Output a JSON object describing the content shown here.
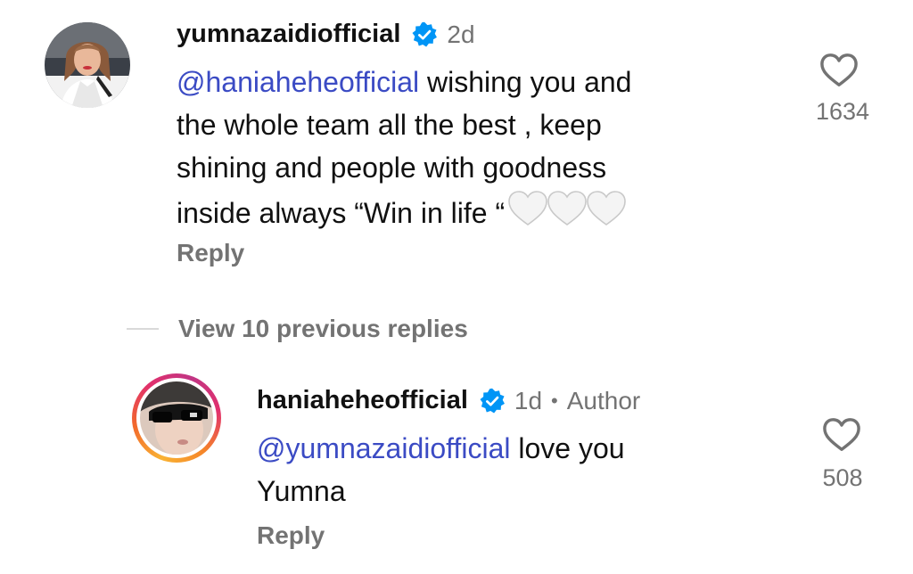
{
  "comment": {
    "username": "yumnazaidiofficial",
    "verified": true,
    "time": "2d",
    "mention": "@haniaheheofficial",
    "lines": [
      " wishing you and",
      "the whole team all the best , keep",
      "shining and people with goodness",
      "inside always “Win in life “"
    ],
    "emoji_icons": [
      "white-heart-icon",
      "white-heart-icon",
      "white-heart-icon"
    ],
    "reply_label": "Reply",
    "likes": "1634",
    "avatar_icon": "profile-avatar"
  },
  "view_replies_label": "View 10 previous replies",
  "reply": {
    "username": "haniaheheofficial",
    "verified": true,
    "time": "1d",
    "separator": "•",
    "badge": "Author",
    "mention": "@yumnazaidiofficial",
    "lines": [
      " love you",
      "Yumna"
    ],
    "reply_label": "Reply",
    "likes": "508",
    "avatar_icon": "profile-avatar-story-ring"
  },
  "colors": {
    "mention": "#3b4bc4",
    "verified": "#0095f6",
    "muted": "#737373",
    "text": "#111111"
  }
}
